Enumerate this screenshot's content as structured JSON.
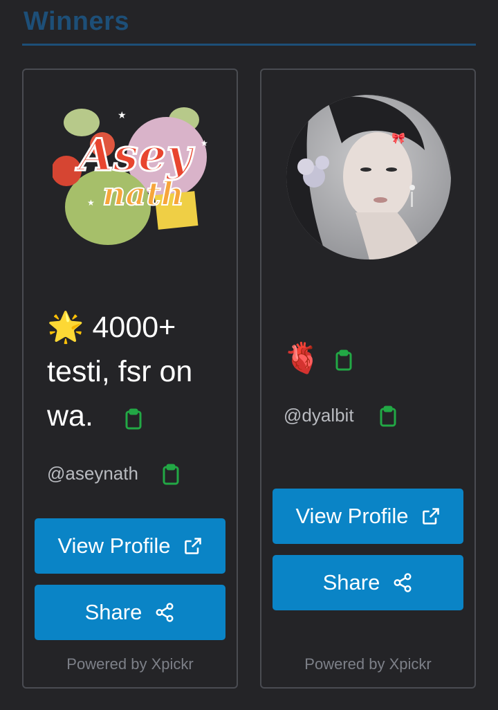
{
  "section": {
    "title": "Winners"
  },
  "winners": [
    {
      "name": "🌟 4000+ testi, fsr on wa.",
      "handle": "@aseynath",
      "logo_text_top": "Asey",
      "logo_text_bottom": "nath",
      "view_label": "View Profile",
      "share_label": "Share",
      "powered_by": "Powered by Xpickr"
    },
    {
      "name": "🫀",
      "handle": "@dyalbit",
      "view_label": "View Profile",
      "share_label": "Share",
      "powered_by": "Powered by Xpickr"
    }
  ],
  "colors": {
    "background": "#242427",
    "title": "#1d4f78",
    "button": "#0a84c6",
    "copy_icon": "#22a845",
    "card_border": "#4a4c52"
  },
  "icons": {
    "copy": "clipboard-icon",
    "external": "external-link-icon",
    "share": "share-icon"
  }
}
